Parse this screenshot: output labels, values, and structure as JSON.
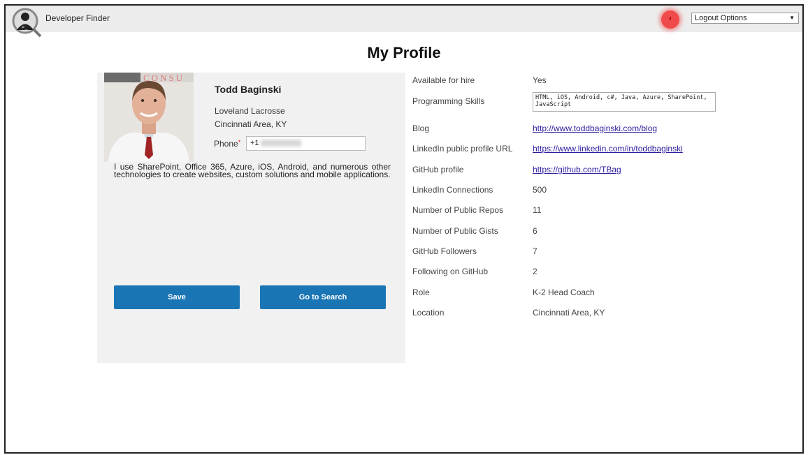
{
  "app": {
    "title": "Developer Finder",
    "logout_label": "Logout Options",
    "logo_icon": "developer-magnifier-icon"
  },
  "page": {
    "title": "My Profile"
  },
  "profile": {
    "name": "Todd Baginski",
    "organization": "Loveland Lacrosse",
    "location": "Cincinnati Area, KY",
    "phone_label": "Phone",
    "phone_value": "+1",
    "bio": "I use SharePoint, Office 365, Azure, iOS, Android, and numerous other technologies to create websites, custom solutions and mobile applications.",
    "photo_banner": "CONSU"
  },
  "actions": {
    "save": "Save",
    "search": "Go to Search"
  },
  "details": [
    {
      "label": "Available for hire",
      "value": "Yes"
    },
    {
      "label": "Programming Skills",
      "value": "HTML, iOS, Android, c#, Java, Azure, SharePoint, JavaScript"
    },
    {
      "label": "Blog",
      "value": "http://www.toddbaginski.com/blog"
    },
    {
      "label": "LinkedIn public profile URL",
      "value": "https://www.linkedin.com/in/toddbaginski"
    },
    {
      "label": "GitHub profile",
      "value": "https://github.com/TBag"
    },
    {
      "label": "LinkedIn Connections",
      "value": "500"
    },
    {
      "label": "Number of Public Repos",
      "value": "11"
    },
    {
      "label": "Number of Public Gists",
      "value": "6"
    },
    {
      "label": "GitHub Followers",
      "value": "7"
    },
    {
      "label": "Following on GitHub",
      "value": "2"
    },
    {
      "label": "Role",
      "value": "K-2 Head Coach"
    },
    {
      "label": "Location",
      "value": "Cincinnati Area, KY"
    }
  ],
  "colors": {
    "primary_button": "#1a75b4",
    "link": "#2a1d9e",
    "notification": "#f04b4b"
  }
}
